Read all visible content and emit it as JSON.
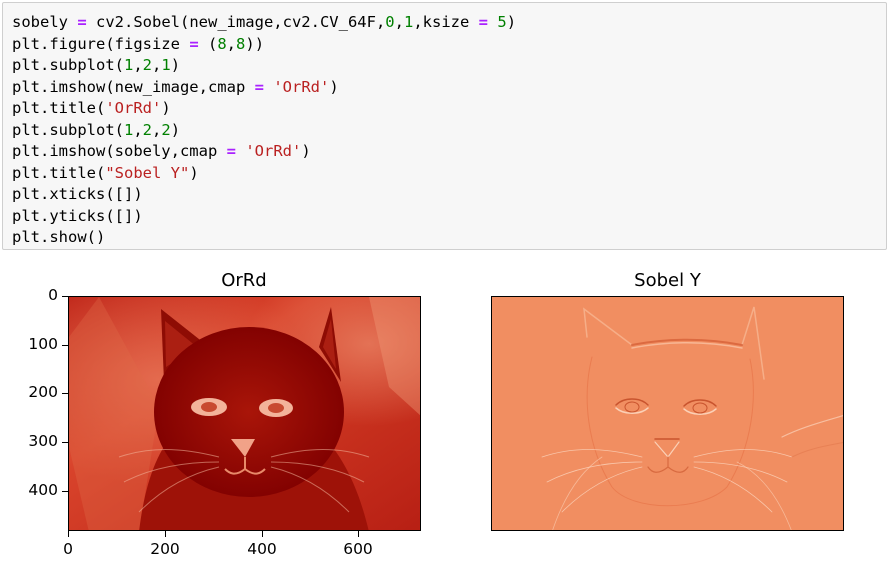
{
  "code_cell": {
    "lines": [
      [
        {
          "t": "sobely "
        },
        {
          "t": "=",
          "c": "op"
        },
        {
          "t": " cv2.Sobel(new_image,cv2.CV_64F,"
        },
        {
          "t": "0",
          "c": "num"
        },
        {
          "t": ","
        },
        {
          "t": "1",
          "c": "num"
        },
        {
          "t": ",ksize "
        },
        {
          "t": "=",
          "c": "op"
        },
        {
          "t": " "
        },
        {
          "t": "5",
          "c": "num"
        },
        {
          "t": ")"
        }
      ],
      [
        {
          "t": "plt.figure(figsize "
        },
        {
          "t": "=",
          "c": "op"
        },
        {
          "t": " ("
        },
        {
          "t": "8",
          "c": "num"
        },
        {
          "t": ","
        },
        {
          "t": "8",
          "c": "num"
        },
        {
          "t": "))"
        }
      ],
      [
        {
          "t": "plt.subplot("
        },
        {
          "t": "1",
          "c": "num"
        },
        {
          "t": ","
        },
        {
          "t": "2",
          "c": "num"
        },
        {
          "t": ","
        },
        {
          "t": "1",
          "c": "num"
        },
        {
          "t": ")"
        }
      ],
      [
        {
          "t": "plt.imshow(new_image,cmap "
        },
        {
          "t": "=",
          "c": "op"
        },
        {
          "t": " "
        },
        {
          "t": "'OrRd'",
          "c": "str"
        },
        {
          "t": ")"
        }
      ],
      [
        {
          "t": "plt.title("
        },
        {
          "t": "'OrRd'",
          "c": "str"
        },
        {
          "t": ")"
        }
      ],
      [
        {
          "t": "plt.subplot("
        },
        {
          "t": "1",
          "c": "num"
        },
        {
          "t": ","
        },
        {
          "t": "2",
          "c": "num"
        },
        {
          "t": ","
        },
        {
          "t": "2",
          "c": "num"
        },
        {
          "t": ")"
        }
      ],
      [
        {
          "t": "plt.imshow(sobely,cmap "
        },
        {
          "t": "=",
          "c": "op"
        },
        {
          "t": " "
        },
        {
          "t": "'OrRd'",
          "c": "str"
        },
        {
          "t": ")"
        }
      ],
      [
        {
          "t": "plt.title("
        },
        {
          "t": "\"Sobel Y\"",
          "c": "str"
        },
        {
          "t": ")"
        }
      ],
      [
        {
          "t": "plt.xticks([])"
        }
      ],
      [
        {
          "t": "plt.yticks([])"
        }
      ],
      [
        {
          "t": "plt.show()"
        }
      ]
    ]
  },
  "output": {
    "left_plot": {
      "title": "OrRd",
      "colormap": "OrRd",
      "yticks": [
        "0",
        "100",
        "200",
        "300",
        "400"
      ],
      "xticks": [
        "0",
        "200",
        "400",
        "600"
      ],
      "image_subject": "cat"
    },
    "right_plot": {
      "title": "Sobel Y",
      "colormap": "OrRd",
      "image_subject": "cat edges (Sobel Y)"
    }
  },
  "colors": {
    "cell_background": "#f7f7f7",
    "cell_border": "#cfcfcf",
    "operator": "#aa22ff",
    "number": "#008000",
    "string": "#ba2121"
  }
}
